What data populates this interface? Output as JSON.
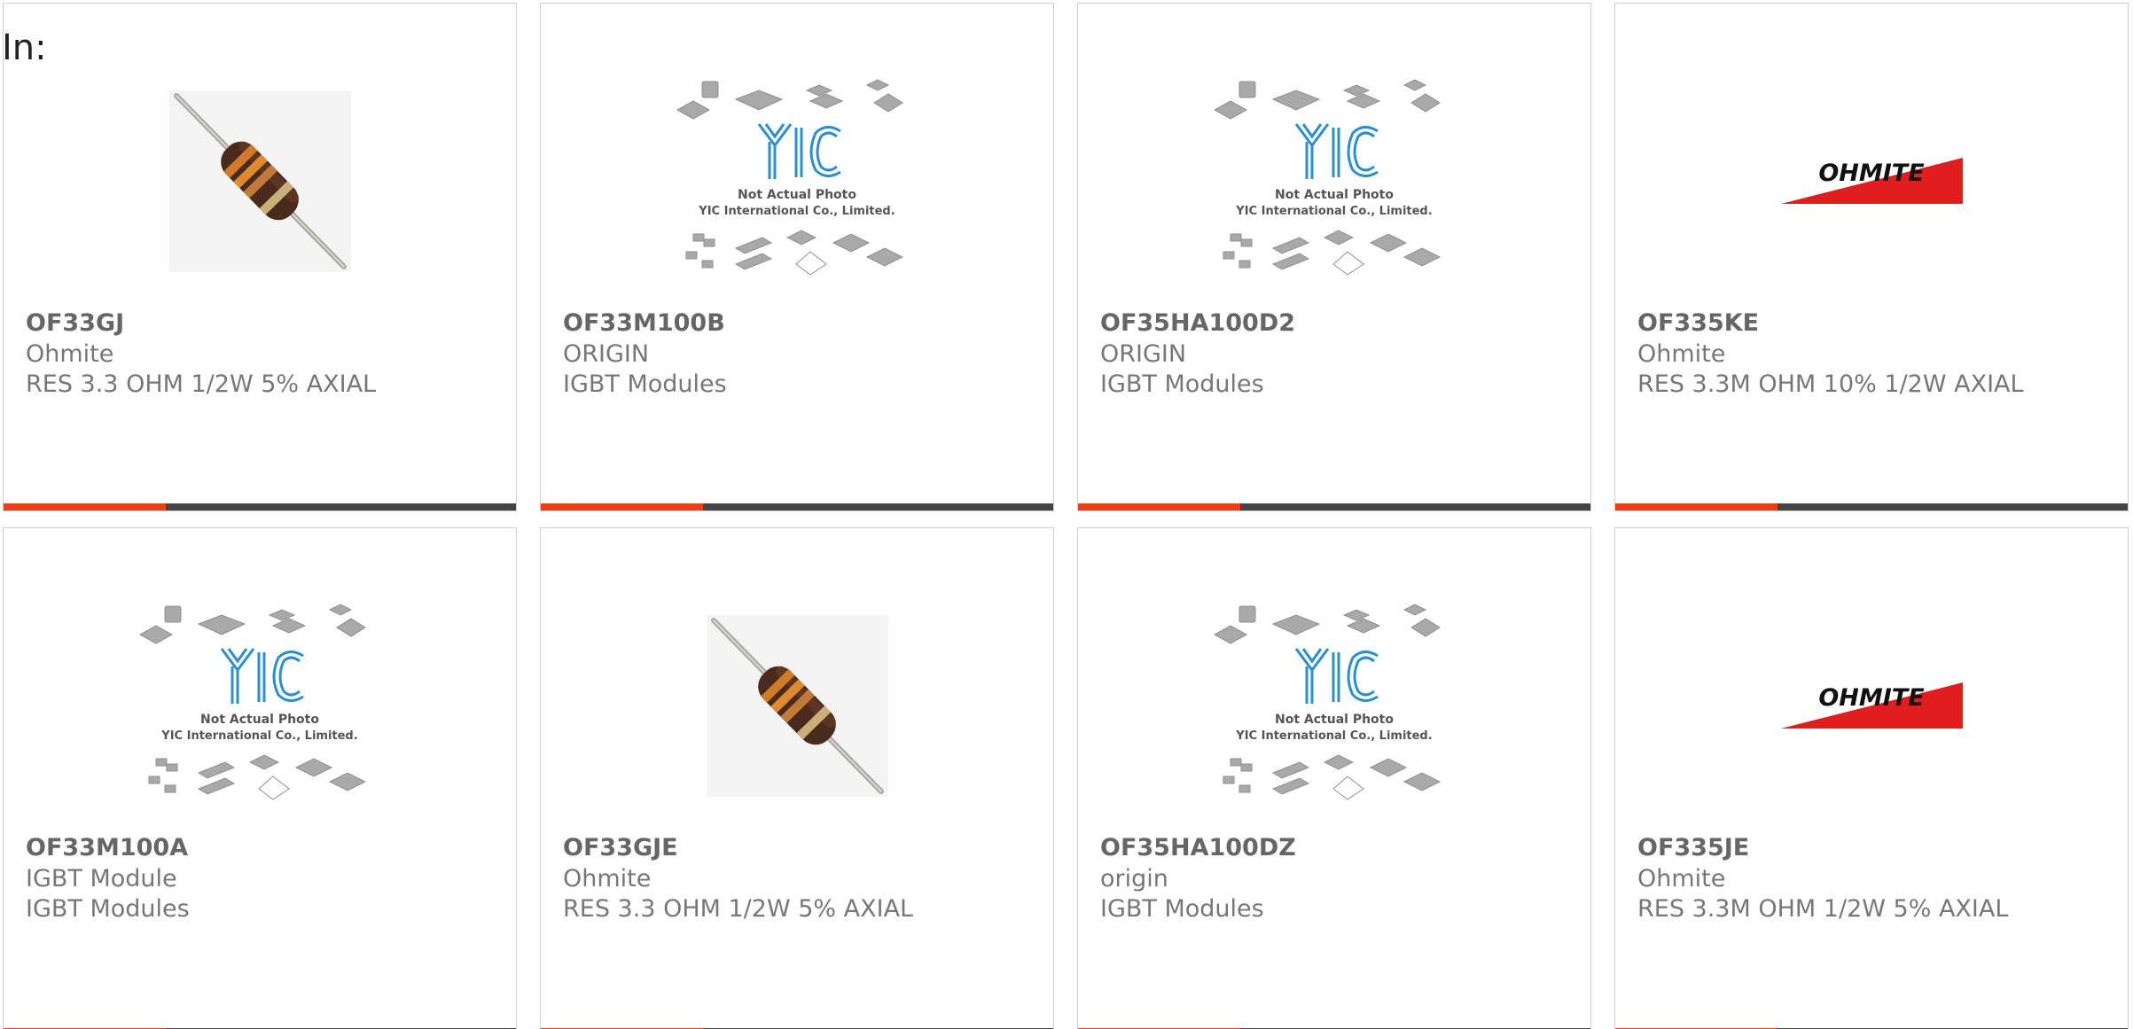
{
  "header": {
    "label": "In:"
  },
  "colors": {
    "accent": "#e8411a",
    "bar": "#444444",
    "ohmite_red": "#e01e1e"
  },
  "image_placeholder": {
    "line1": "Not Actual Photo",
    "line2": "YIC International Co., Limited.",
    "logo": "YIC"
  },
  "ohmite_logo_text": "OHMITE",
  "cards": [
    {
      "part": "OF33GJ",
      "manufacturer": "Ohmite",
      "description": "RES 3.3 OHM 1/2W 5% AXIAL",
      "image": "resistor"
    },
    {
      "part": "OF33M100B",
      "manufacturer": "ORIGIN",
      "description": "IGBT Modules",
      "image": "yic"
    },
    {
      "part": "OF35HA100D2",
      "manufacturer": "ORIGIN",
      "description": "IGBT Modules",
      "image": "yic"
    },
    {
      "part": "OF335KE",
      "manufacturer": "Ohmite",
      "description": "RES 3.3M OHM 10% 1/2W AXIAL",
      "image": "ohmite"
    },
    {
      "part": "OF33M100A",
      "manufacturer": "IGBT Module",
      "description": "IGBT Modules",
      "image": "yic"
    },
    {
      "part": "OF33GJE",
      "manufacturer": "Ohmite",
      "description": "RES 3.3 OHM 1/2W 5% AXIAL",
      "image": "resistor"
    },
    {
      "part": "OF35HA100DZ",
      "manufacturer": "origin",
      "description": "IGBT Modules",
      "image": "yic"
    },
    {
      "part": "OF335JE",
      "manufacturer": "Ohmite",
      "description": "RES 3.3M OHM 1/2W 5% AXIAL",
      "image": "ohmite"
    }
  ]
}
